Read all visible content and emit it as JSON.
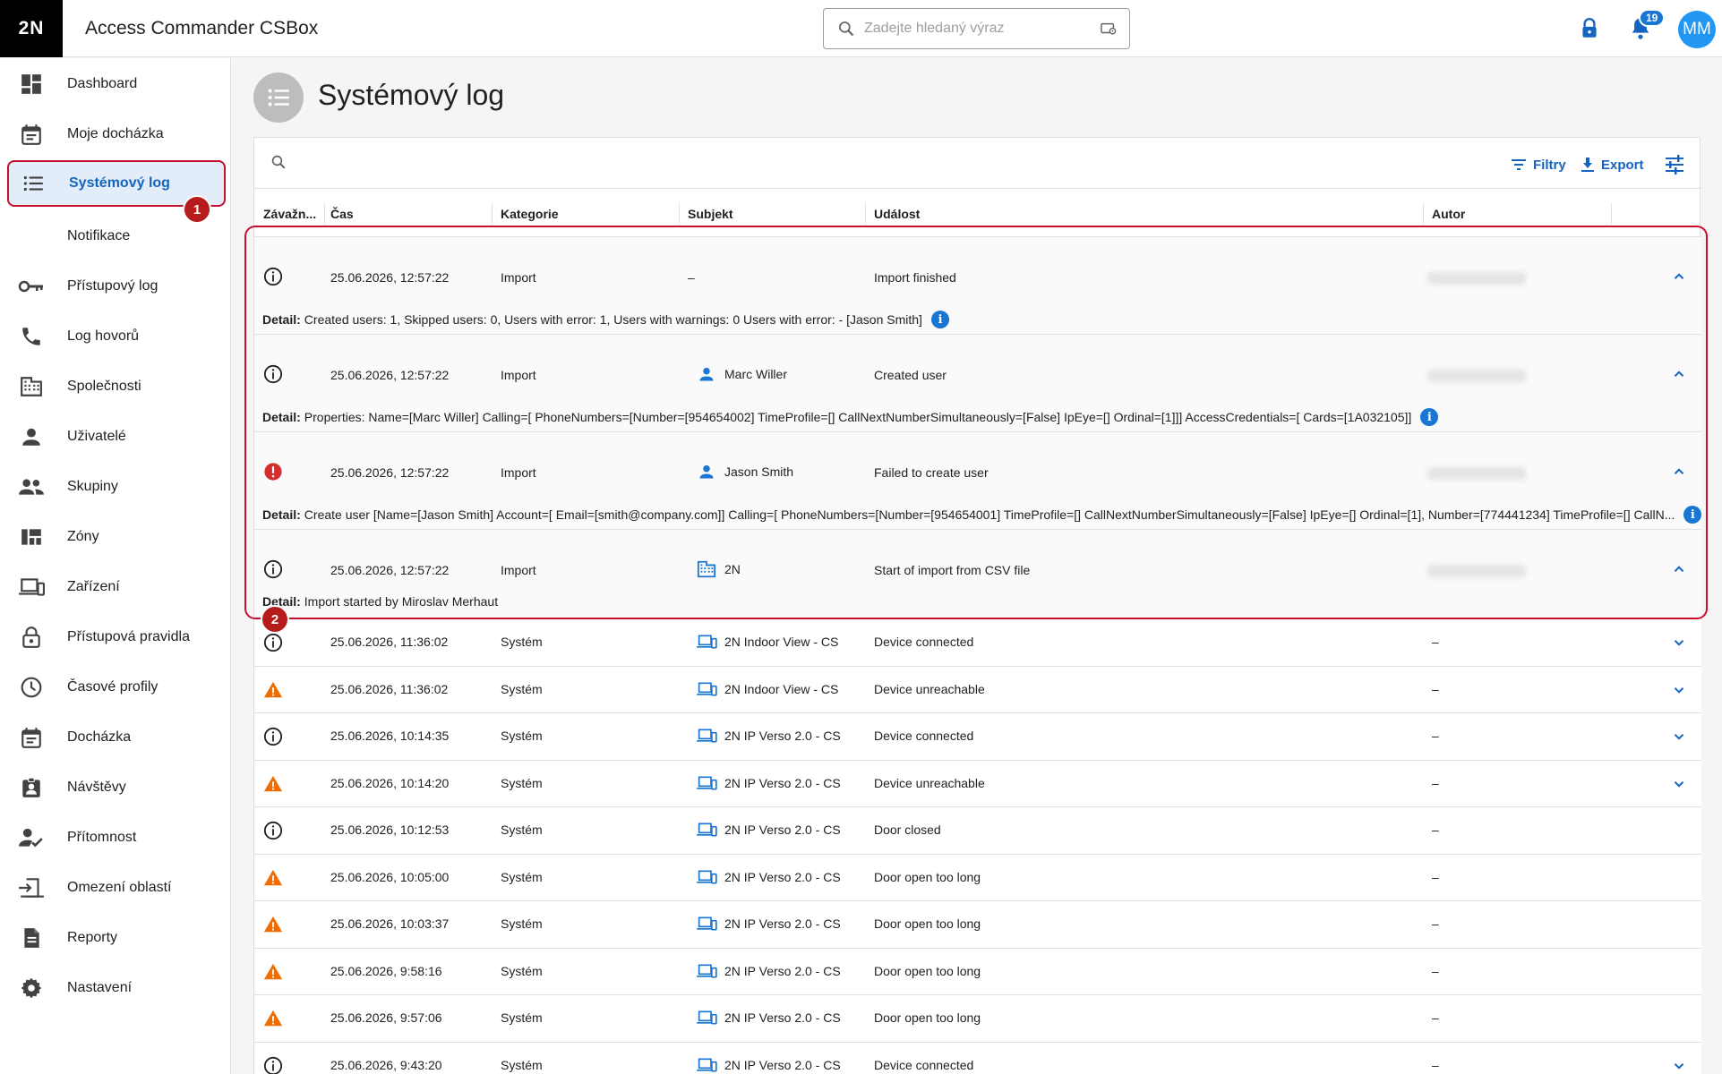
{
  "header": {
    "logo": "2N",
    "app_title": "Access Commander CSBox",
    "search_placeholder": "Zadejte hledaný výraz",
    "notification_count": "19",
    "avatar_initials": "MM"
  },
  "sidebar": {
    "items": [
      {
        "label": "Dashboard",
        "icon": "dashboard-icon"
      },
      {
        "label": "Moje docházka",
        "icon": "calendar-icon"
      },
      {
        "label": "Systémový log",
        "icon": "list-icon",
        "active": true
      },
      {
        "label": "Notifikace",
        "icon": "",
        "sub": true
      },
      {
        "label": "Přístupový log",
        "icon": "key-icon"
      },
      {
        "label": "Log hovorů",
        "icon": "phone-icon"
      },
      {
        "label": "Společnosti",
        "icon": "building-icon"
      },
      {
        "label": "Uživatelé",
        "icon": "person-icon"
      },
      {
        "label": "Skupiny",
        "icon": "group-icon"
      },
      {
        "label": "Zóny",
        "icon": "zones-icon"
      },
      {
        "label": "Zařízení",
        "icon": "devices-icon"
      },
      {
        "label": "Přístupová pravidla",
        "icon": "lock-icon"
      },
      {
        "label": "Časové profily",
        "icon": "clock-icon"
      },
      {
        "label": "Docházka",
        "icon": "calendar-icon"
      },
      {
        "label": "Návštěvy",
        "icon": "badge-icon"
      },
      {
        "label": "Přítomnost",
        "icon": "person-check-icon"
      },
      {
        "label": "Omezení oblastí",
        "icon": "area-limit-icon"
      },
      {
        "label": "Reporty",
        "icon": "report-icon"
      },
      {
        "label": "Nastavení",
        "icon": "gear-icon"
      }
    ],
    "callout_number": "1"
  },
  "page": {
    "title": "Systémový log",
    "callout_number": "2"
  },
  "toolbar": {
    "filters_label": "Filtry",
    "export_label": "Export"
  },
  "table": {
    "columns": [
      "Závažn...",
      "Čas",
      "Kategorie",
      "Subjekt",
      "Událost",
      "Autor"
    ],
    "detail_label": "Detail:",
    "rows": [
      {
        "severity": "info",
        "time": "25.06.2026, 12:57:22",
        "category": "Import",
        "subject": "–",
        "subject_icon": "",
        "event": "Import finished",
        "author": "",
        "author_blurred": true,
        "expanded": true,
        "detail": "Created users: 1, Skipped users: 0, Users with error: 1, Users with warnings: 0 Users with error: - [Jason Smith]",
        "detail_info": true
      },
      {
        "severity": "info",
        "time": "25.06.2026, 12:57:22",
        "category": "Import",
        "subject": "Marc Willer",
        "subject_icon": "person-icon",
        "event": "Created user",
        "author": "",
        "author_blurred": true,
        "expanded": true,
        "detail": "Properties: Name=[Marc Willer] Calling=[ PhoneNumbers=[Number=[954654002] TimeProfile=[] CallNextNumberSimultaneously=[False] IpEye=[] Ordinal=[1]]] AccessCredentials=[ Cards=[1A032105]]",
        "detail_info": true
      },
      {
        "severity": "error",
        "time": "25.06.2026, 12:57:22",
        "category": "Import",
        "subject": "Jason Smith",
        "subject_icon": "person-icon",
        "event": "Failed to create user",
        "author": "",
        "author_blurred": true,
        "expanded": true,
        "detail": "Create user [Name=[Jason Smith] Account=[ Email=[smith@company.com]] Calling=[ PhoneNumbers=[Number=[954654001] TimeProfile=[] CallNextNumberSimultaneously=[False] IpEye=[] Ordinal=[1], Number=[774441234] TimeProfile=[] CallN...",
        "detail_info": true
      },
      {
        "severity": "info",
        "time": "25.06.2026, 12:57:22",
        "category": "Import",
        "subject": "2N",
        "subject_icon": "building-icon",
        "event": "Start of import from CSV file",
        "author": "",
        "author_blurred": true,
        "expanded": true,
        "detail": "Import started by Miroslav Merhaut",
        "detail_info": false
      },
      {
        "severity": "info",
        "time": "25.06.2026, 11:36:02",
        "category": "Systém",
        "subject": "2N Indoor View - CS",
        "subject_icon": "devices-icon",
        "event": "Device connected",
        "author": "–",
        "expandable": true
      },
      {
        "severity": "warning",
        "time": "25.06.2026, 11:36:02",
        "category": "Systém",
        "subject": "2N Indoor View - CS",
        "subject_icon": "devices-icon",
        "event": "Device unreachable",
        "author": "–",
        "expandable": true
      },
      {
        "severity": "info",
        "time": "25.06.2026, 10:14:35",
        "category": "Systém",
        "subject": "2N IP Verso 2.0 - CS",
        "subject_icon": "devices-icon",
        "event": "Device connected",
        "author": "–",
        "expandable": true
      },
      {
        "severity": "warning",
        "time": "25.06.2026, 10:14:20",
        "category": "Systém",
        "subject": "2N IP Verso 2.0 - CS",
        "subject_icon": "devices-icon",
        "event": "Device unreachable",
        "author": "–",
        "expandable": true
      },
      {
        "severity": "info",
        "time": "25.06.2026, 10:12:53",
        "category": "Systém",
        "subject": "2N IP Verso 2.0 - CS",
        "subject_icon": "devices-icon",
        "event": "Door closed",
        "author": "–",
        "expandable": false
      },
      {
        "severity": "warning",
        "time": "25.06.2026, 10:05:00",
        "category": "Systém",
        "subject": "2N IP Verso 2.0 - CS",
        "subject_icon": "devices-icon",
        "event": "Door open too long",
        "author": "–",
        "expandable": false
      },
      {
        "severity": "warning",
        "time": "25.06.2026, 10:03:37",
        "category": "Systém",
        "subject": "2N IP Verso 2.0 - CS",
        "subject_icon": "devices-icon",
        "event": "Door open too long",
        "author": "–",
        "expandable": false
      },
      {
        "severity": "warning",
        "time": "25.06.2026, 9:58:16",
        "category": "Systém",
        "subject": "2N IP Verso 2.0 - CS",
        "subject_icon": "devices-icon",
        "event": "Door open too long",
        "author": "–",
        "expandable": false
      },
      {
        "severity": "warning",
        "time": "25.06.2026, 9:57:06",
        "category": "Systém",
        "subject": "2N IP Verso 2.0 - CS",
        "subject_icon": "devices-icon",
        "event": "Door open too long",
        "author": "–",
        "expandable": false
      },
      {
        "severity": "info",
        "time": "25.06.2026, 9:43:20",
        "category": "Systém",
        "subject": "2N IP Verso 2.0 - CS",
        "subject_icon": "devices-icon",
        "event": "Device connected",
        "author": "–",
        "expandable": true
      }
    ]
  },
  "colors": {
    "accent": "#1565c0",
    "highlight": "#c8102e",
    "error": "#d32f2f",
    "warning": "#ef6c00",
    "active_bg": "#e3edf9"
  }
}
